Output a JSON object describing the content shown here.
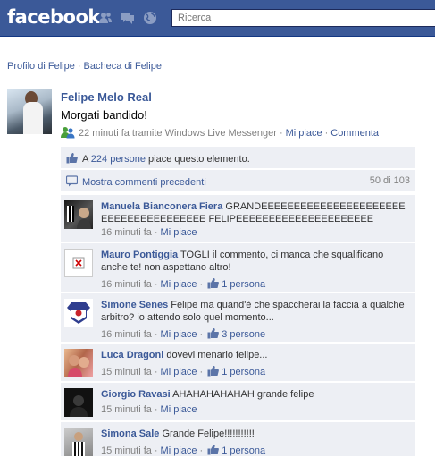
{
  "app": {
    "logo_text": "facebook"
  },
  "search": {
    "placeholder": "Ricerca"
  },
  "breadcrumb": {
    "profile": "Profilo di Felipe",
    "wall": "Bacheca di Felipe"
  },
  "post": {
    "author": "Felipe Melo Real",
    "message": "Morgati bandido!",
    "time": "22 minuti fa tramite Windows Live Messenger",
    "like_label": "Mi piace",
    "comment_label": "Commenta",
    "likes_prefix": "A",
    "likes_count": "224 persone",
    "likes_suffix": "piace questo elemento.",
    "show_more": "Mostra commenti precedenti",
    "comment_count": "50 di 103"
  },
  "comments": [
    {
      "name": "Manuela Bianconera Fiera",
      "text": "GRANDEEEEEEEEEEEEEEEEEEEEEE EEEEEEEEEEEEEEEE FELIPEEEEEEEEEEEEEEEEEEEEE",
      "time": "16 minuti fa",
      "like": "Mi piace",
      "likes": ""
    },
    {
      "name": "Mauro Pontiggia",
      "text": "TOGLI il commento, ci manca che squalificano anche te! non aspettano altro!",
      "time": "16 minuti fa",
      "like": "Mi piace",
      "likes": "1 persona"
    },
    {
      "name": "Simone Senes",
      "text": "Felipe ma quand'è che spaccherai la faccia a qualche arbitro? io attendo solo quel momento...",
      "time": "16 minuti fa",
      "like": "Mi piace",
      "likes": "3 persone"
    },
    {
      "name": "Luca Dragoni",
      "text": "dovevi menarlo felipe...",
      "time": "15 minuti fa",
      "like": "Mi piace",
      "likes": "1 persona"
    },
    {
      "name": "Giorgio Ravasi",
      "text": "AHAHAHAHAHAH grande felipe",
      "time": "15 minuti fa",
      "like": "Mi piace",
      "likes": ""
    },
    {
      "name": "Simona Sale",
      "text": "Grande Felipe!!!!!!!!!!!",
      "time": "15 minuti fa",
      "like": "Mi piace",
      "likes": "1 persona"
    }
  ],
  "colors": {
    "brand": "#3b5998",
    "ufi_bg": "#edeff4"
  }
}
